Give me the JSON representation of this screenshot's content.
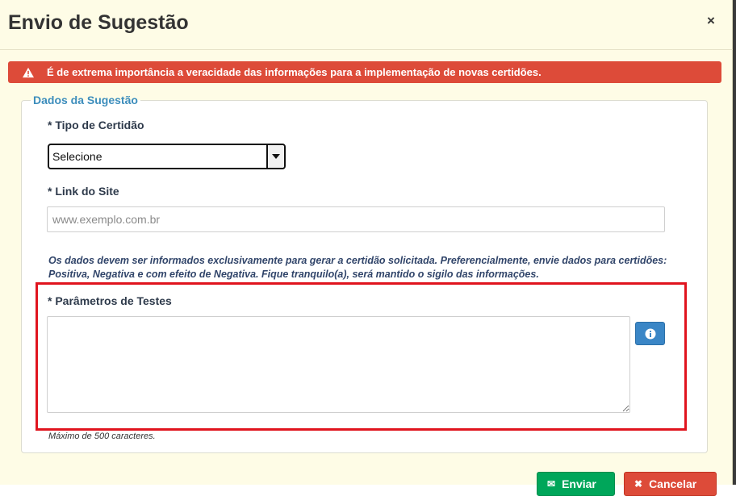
{
  "modal": {
    "title": "Envio de Sugestão",
    "close_glyph": "×"
  },
  "alert": {
    "text": "É de extrema importância a veracidade das informações para a implementação de novas certidões.",
    "icon": "warning-triangle-icon",
    "color": "#dd4b39"
  },
  "form": {
    "legend": "Dados da Sugestão",
    "tipo": {
      "label": "* Tipo de Certidão",
      "selected": "Selecione"
    },
    "link": {
      "label": "* Link do Site",
      "placeholder": "www.exemplo.com.br",
      "value": ""
    },
    "help_text": "Os dados devem ser informados exclusivamente para gerar a certidão solicitada. Preferencialmente, envie dados para certidões: Positiva, Negativa e com efeito de Negativa. Fique tranquilo(a), será mantido o sigilo das informações.",
    "params": {
      "label": "* Parâmetros de Testes",
      "value": "",
      "max_note": "Máximo de 500 caracteres.",
      "info_icon": "info-icon"
    }
  },
  "footer": {
    "send_label": "Enviar",
    "cancel_label": "Cancelar",
    "send_color": "#00a65a",
    "cancel_color": "#dd4b39"
  }
}
